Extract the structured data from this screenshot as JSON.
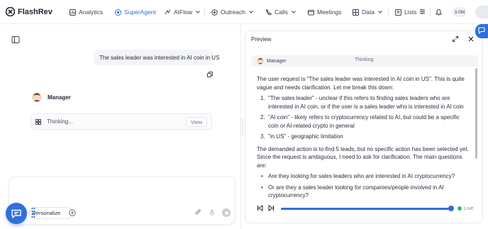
{
  "app": {
    "name": "FlashRev",
    "credits": "3.0M"
  },
  "nav": {
    "items": [
      {
        "label": "Analytics",
        "icon": "chart-icon"
      },
      {
        "label": "SuperAgent",
        "icon": "agent-icon",
        "active": true
      },
      {
        "label": "AIFlow",
        "icon": "flow-icon"
      },
      {
        "label": "Outreach",
        "icon": "outreach-icon"
      },
      {
        "label": "Calls",
        "icon": "phone-icon"
      },
      {
        "label": "Meetings",
        "icon": "meeting-icon"
      },
      {
        "label": "Data",
        "icon": "database-icon"
      },
      {
        "label": "Lists",
        "icon": "list-icon"
      }
    ]
  },
  "chat": {
    "user_message": "The sales leader was interested in AI coin in US",
    "agent_name": "Manager",
    "thinking_label": "Thinking...",
    "view_label": "View",
    "composer": {
      "personalize_label": "Personalize"
    }
  },
  "preview": {
    "title": "Preview",
    "tab_manager": "Manager",
    "tab_thinking": "Thinking",
    "intro": "The user request is \"The sales leader was interested in AI coin in US\". This is quite vague and needs clarification. Let me break this down:",
    "points": [
      "\"The sales leader\" - unclear if this refers to finding sales leaders who are interested in AI coin, or if the user is a sales leader who is interested in AI coin",
      "\"AI coin\" - likely refers to cryptocurrency related to AI, but could be a specific coin or AI-related crypto in general",
      "\"in US\" - geographic limitation"
    ],
    "analysis": "The demanded action is to find 5 leads, but no specific action has been selected yet. Since the request is ambiguous, I need to ask for clarification. The main questions are:",
    "questions": [
      "Are they looking for sales leaders who are interested in AI cryptocurrency?",
      "Or are they a sales leader looking for companies/people involved in AI cryptocurrency?"
    ],
    "live_label": "Live"
  },
  "colors": {
    "accent": "#2f6fdb",
    "live": "#2ebd6b"
  }
}
